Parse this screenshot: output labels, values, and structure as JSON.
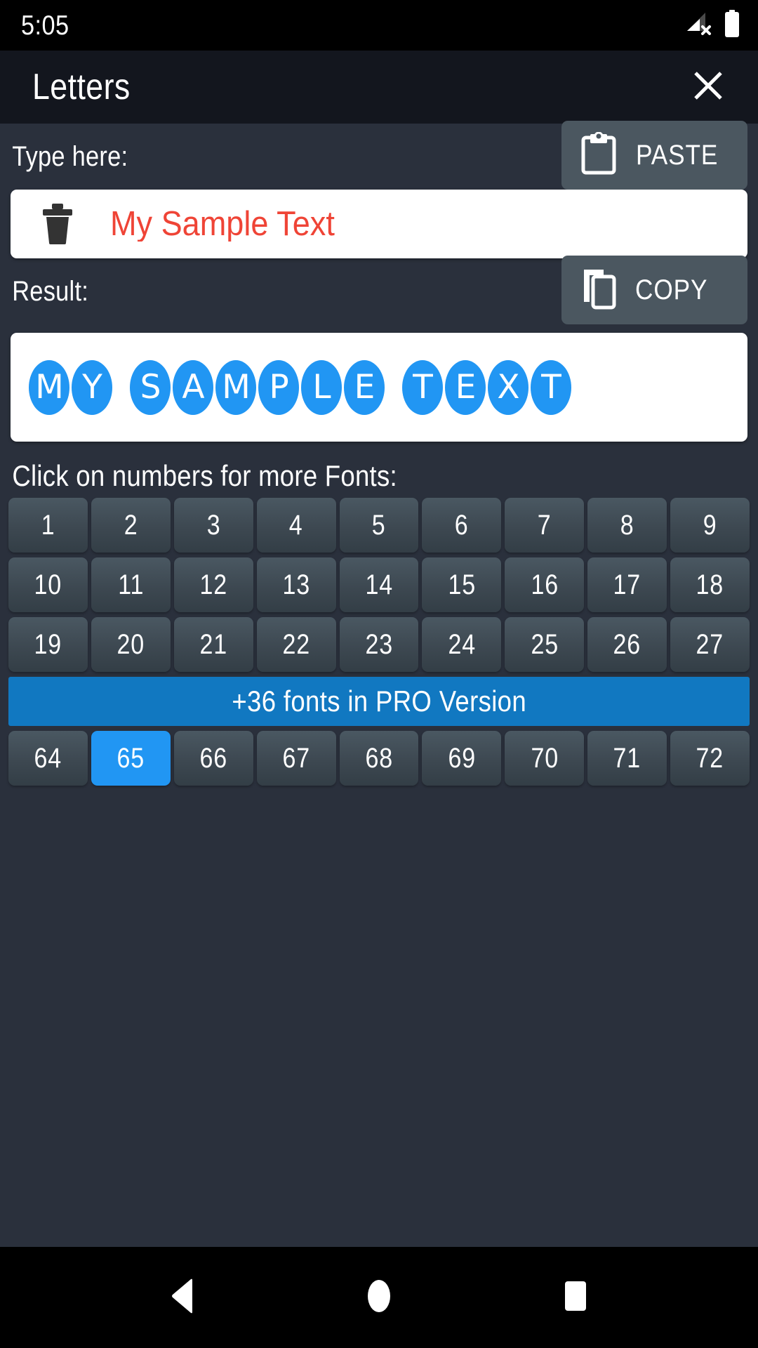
{
  "status_bar": {
    "clock": "5:05",
    "signal_icon": "signal-no-service-icon",
    "battery_icon": "battery-full-icon"
  },
  "title_bar": {
    "title": "Letters",
    "close_icon": "close-icon"
  },
  "input_section": {
    "label": "Type here:",
    "paste_button": {
      "label": "PASTE",
      "icon": "clipboard-icon"
    },
    "clear_icon": "trash-icon",
    "value": "My Sample Text",
    "placeholder": "Type here:",
    "text_color": "#EF4436"
  },
  "result_section": {
    "label": "Result:",
    "copy_button": {
      "label": "COPY",
      "icon": "copy-icon"
    },
    "value": "🅜🅨 🅢🅐🅜🅟🅛🅔 🅣🅔🅧🅣",
    "value_plain": "MY SAMPLE TEXT",
    "circle_color": "#2196F3"
  },
  "fonts_section": {
    "heading": "Click on numbers for more Fonts:",
    "rows": [
      [
        "1",
        "2",
        "3",
        "4",
        "5",
        "6",
        "7",
        "8",
        "9"
      ],
      [
        "10",
        "11",
        "12",
        "13",
        "14",
        "15",
        "16",
        "17",
        "18"
      ],
      [
        "19",
        "20",
        "21",
        "22",
        "23",
        "24",
        "25",
        "26",
        "27"
      ]
    ],
    "pro_banner": "+36 fonts in PRO Version",
    "rows_after_banner": [
      [
        "64",
        "65",
        "66",
        "67",
        "68",
        "69",
        "70",
        "71",
        "72"
      ]
    ],
    "selected": "65",
    "selected_color": "#2196F3",
    "banner_color": "#1178C1"
  },
  "nav_bar": {
    "back_icon": "back-triangle-icon",
    "home_icon": "home-circle-icon",
    "recents_icon": "recents-square-icon"
  },
  "theme": {
    "background": "#2A303C",
    "title_bar": "#13161E",
    "action_button": "#4B5760",
    "accent": "#2196F3"
  }
}
